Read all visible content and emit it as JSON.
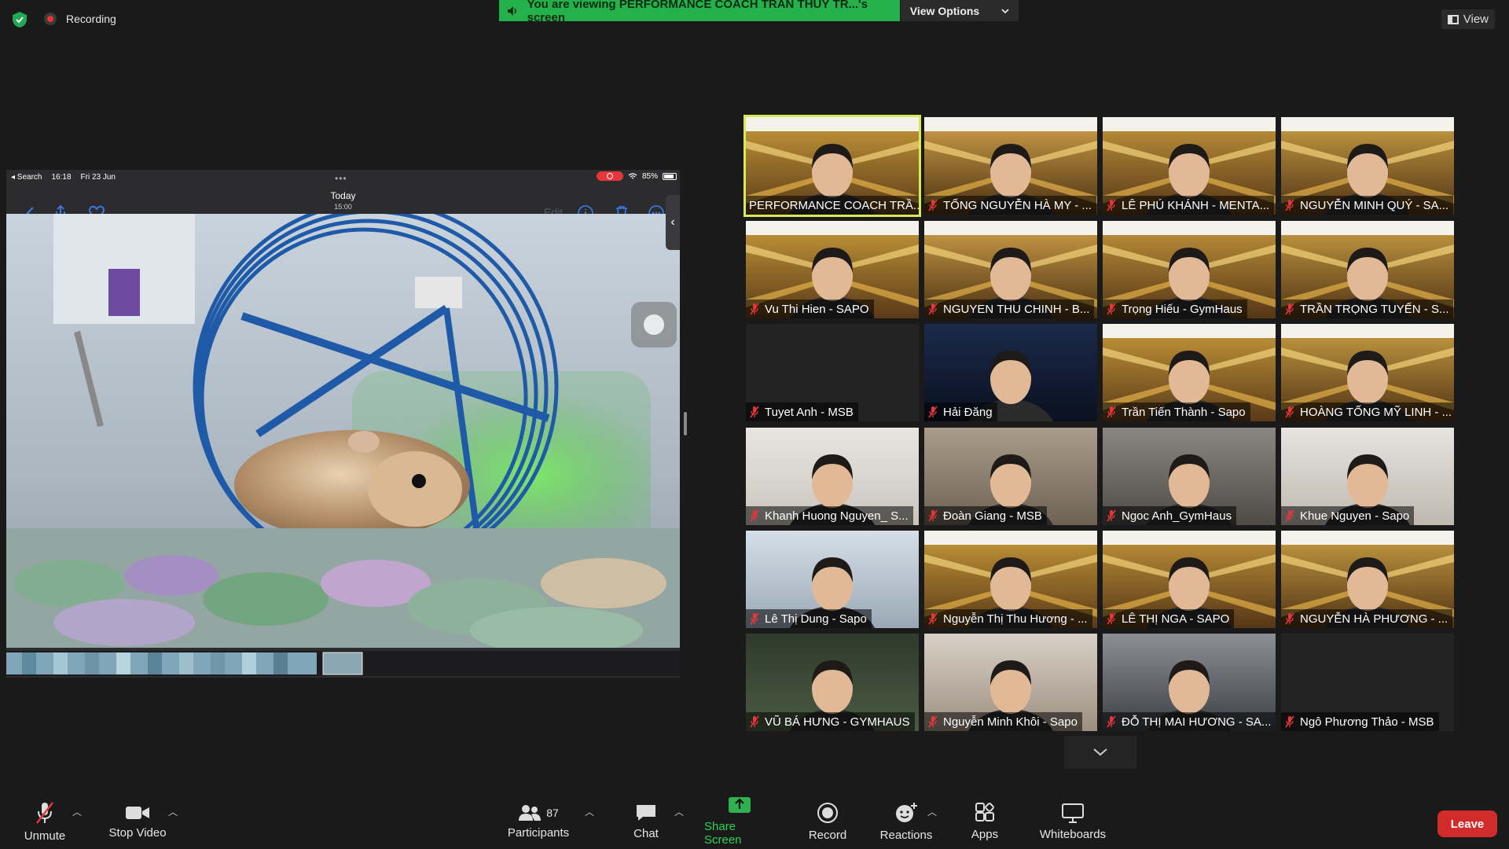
{
  "top": {
    "recording_label": "Recording",
    "banner_text": "You are viewing PERFORMANCE COACH TRẦN THUÝ TR...'s screen",
    "view_options_label": "View Options",
    "view_label": "View"
  },
  "shared_screen": {
    "status_left": "◂ Search",
    "status_time": "16:18",
    "status_date": "Fri 23 Jun",
    "battery": "85%",
    "title": "Today",
    "time": "15:00",
    "edit_label": "Edit"
  },
  "participants": [
    {
      "name": "PERFORMANCE COACH TRẦ...",
      "muted": false,
      "active": true
    },
    {
      "name": "TỐNG NGUYỄN HÀ MY - ...",
      "muted": true
    },
    {
      "name": "LÊ PHÚ KHÁNH - MENTA...",
      "muted": true
    },
    {
      "name": "NGUYỄN MINH QUÝ - SA...",
      "muted": true
    },
    {
      "name": "Vu Thi Hien - SAPO",
      "muted": true
    },
    {
      "name": "NGUYEN THU CHINH - B...",
      "muted": true
    },
    {
      "name": "Trọng Hiếu - GymHaus",
      "muted": true
    },
    {
      "name": "TRẦN TRỌNG TUYẾN - S...",
      "muted": true
    },
    {
      "name": "Tuyet Anh - MSB",
      "muted": true
    },
    {
      "name": "Hải Đăng",
      "muted": true
    },
    {
      "name": "Trần Tiến Thành - Sapo",
      "muted": true
    },
    {
      "name": "HOÀNG TỐNG MỸ LINH - ...",
      "muted": true
    },
    {
      "name": "Khanh Huong Nguyen_ S...",
      "muted": true
    },
    {
      "name": "Đoàn Giang - MSB",
      "muted": true
    },
    {
      "name": "Ngoc Anh_GymHaus",
      "muted": true
    },
    {
      "name": "Khue Nguyen - Sapo",
      "muted": true
    },
    {
      "name": "Lê Thị Dung - Sapo",
      "muted": true
    },
    {
      "name": "Nguyễn Thị Thu Hương - ...",
      "muted": true
    },
    {
      "name": "LÊ THỊ NGA - SAPO",
      "muted": true
    },
    {
      "name": "NGUYỄN HÀ PHƯƠNG - ...",
      "muted": true
    },
    {
      "name": "VŨ BÁ HƯNG - GYMHAUS",
      "muted": true
    },
    {
      "name": "Nguyễn Minh Khôi - Sapo",
      "muted": true
    },
    {
      "name": "ĐỖ THỊ MAI HƯƠNG - SA...",
      "muted": true
    },
    {
      "name": "Ngô Phương Thảo - MSB",
      "muted": true
    }
  ],
  "toolbar": {
    "unmute": "Unmute",
    "stop_video": "Stop Video",
    "participants": "Participants",
    "participants_count": "87",
    "chat": "Chat",
    "share_screen": "Share Screen",
    "record": "Record",
    "reactions": "Reactions",
    "apps": "Apps",
    "whiteboards": "Whiteboards",
    "leave": "Leave"
  },
  "colors": {
    "share_green": "#24b14c",
    "leave_red": "#d22b2b",
    "active_speaker": "#d7e85a",
    "mute_red": "#e5363c"
  }
}
